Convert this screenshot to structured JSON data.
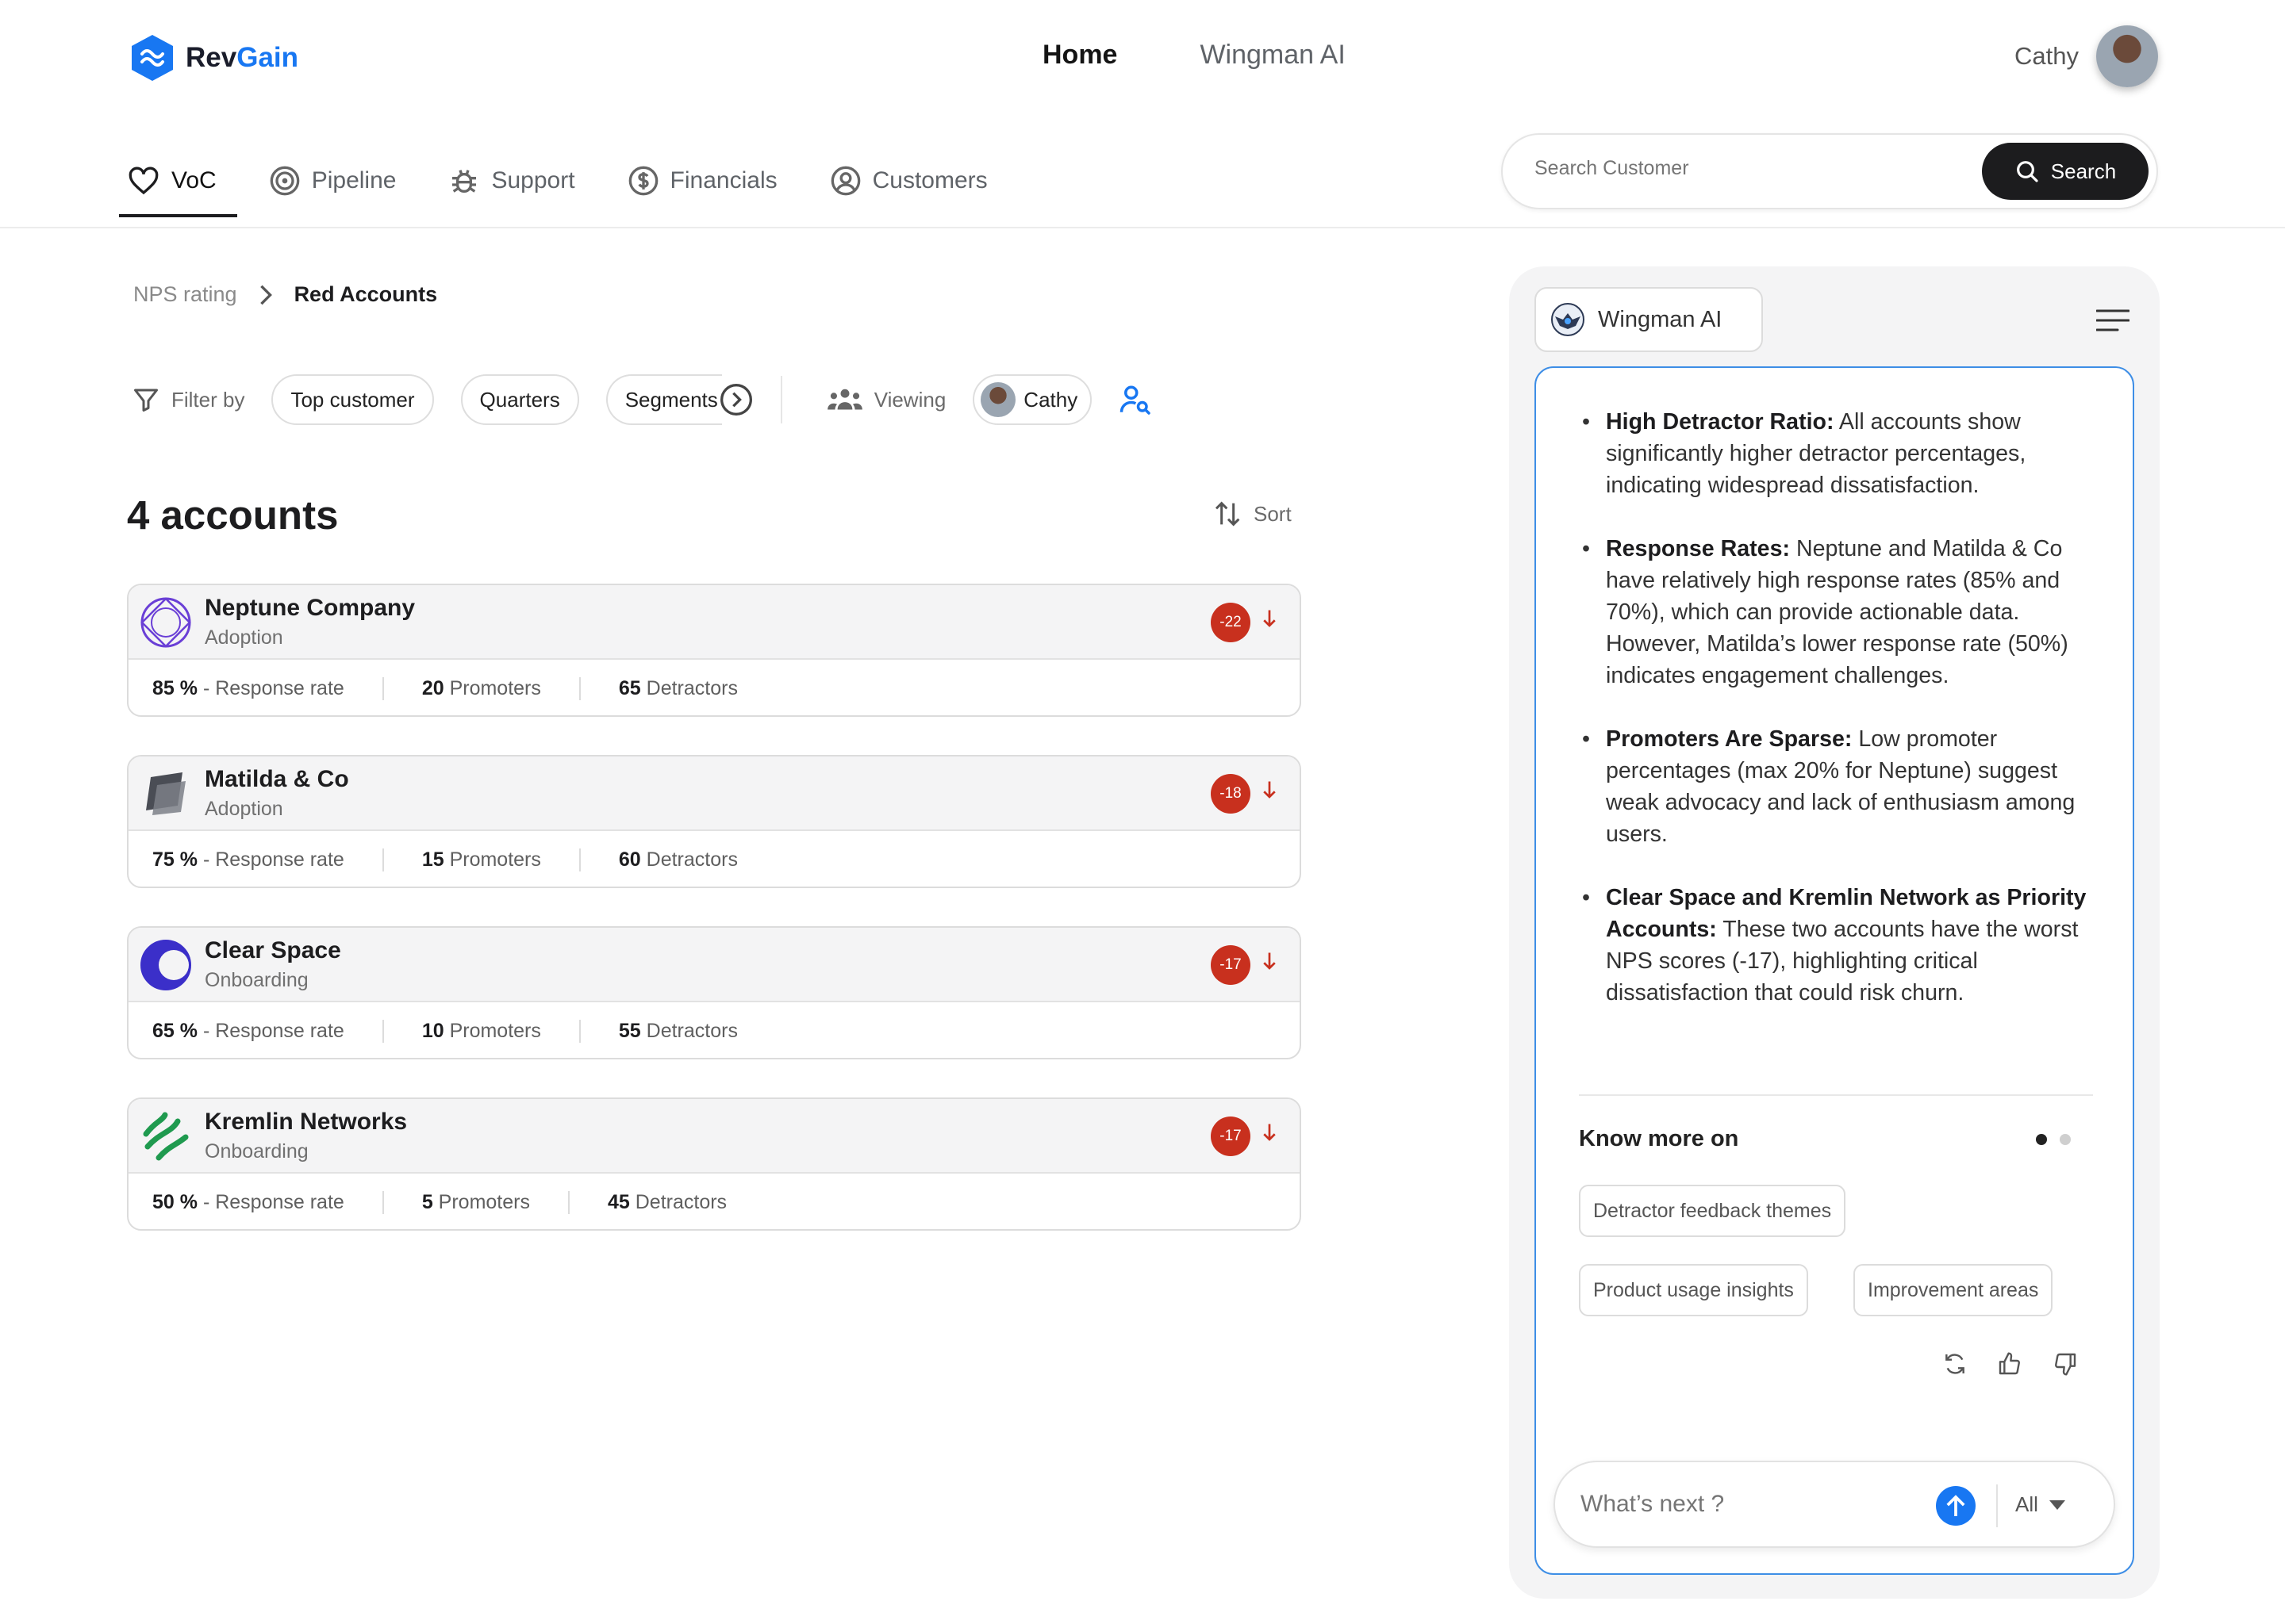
{
  "brand": {
    "name_part1": "Rev",
    "name_part2": "Gain",
    "accent": "#1877f2"
  },
  "topnav": [
    {
      "label": "Home",
      "active": true
    },
    {
      "label": "Wingman AI",
      "active": false
    }
  ],
  "user": {
    "name": "Cathy"
  },
  "subnav": [
    {
      "label": "VoC",
      "icon": "heart-icon",
      "active": true
    },
    {
      "label": "Pipeline",
      "icon": "target-icon"
    },
    {
      "label": "Support",
      "icon": "bug-icon"
    },
    {
      "label": "Financials",
      "icon": "dollar-icon"
    },
    {
      "label": "Customers",
      "icon": "user-circle-icon"
    }
  ],
  "search": {
    "placeholder": "Search Customer",
    "button": "Search"
  },
  "breadcrumb": {
    "parent": "NPS rating",
    "current": "Red Accounts"
  },
  "filters": {
    "label": "Filter by",
    "chips": [
      "Top customer",
      "Quarters",
      "Segments"
    ],
    "viewing_label": "Viewing",
    "viewing_user": "Cathy"
  },
  "accounts": {
    "title": "4 accounts",
    "sort_label": "Sort",
    "score_color": "#c8301e",
    "items": [
      {
        "name": "Neptune Company",
        "stage": "Adoption",
        "score": "-22",
        "response": "85 %",
        "response_label": "- Response rate",
        "promoters": "20",
        "promoters_label": "Promoters",
        "detractors": "65",
        "detractors_label": "Detractors"
      },
      {
        "name": "Matilda & Co",
        "stage": "Adoption",
        "score": "-18",
        "response": "75 %",
        "response_label": "- Response rate",
        "promoters": "15",
        "promoters_label": "Promoters",
        "detractors": "60",
        "detractors_label": "Detractors"
      },
      {
        "name": "Clear Space",
        "stage": "Onboarding",
        "score": "-17",
        "response": "65 %",
        "response_label": "- Response rate",
        "promoters": "10",
        "promoters_label": "Promoters",
        "detractors": "55",
        "detractors_label": "Detractors"
      },
      {
        "name": "Kremlin Networks",
        "stage": "Onboarding",
        "score": "-17",
        "response": "50 %",
        "response_label": "- Response rate",
        "promoters": "5",
        "promoters_label": "Promoters",
        "detractors": "45",
        "detractors_label": "Detractors"
      }
    ]
  },
  "wingman": {
    "title": "Wingman AI",
    "insights": [
      {
        "heading": "High Detractor Ratio:",
        "text": " All accounts show significantly higher detractor percentages, indicating widespread dissatisfaction."
      },
      {
        "heading": "Response Rates:",
        "text": " Neptune and Matilda & Co have relatively high response rates (85% and 70%), which can provide actionable data. However, Matilda’s lower response rate (50%) indicates engagement challenges."
      },
      {
        "heading": "Promoters Are Sparse:",
        "text": " Low promoter percentages (max 20% for Neptune) suggest weak advocacy and lack of enthusiasm among users."
      },
      {
        "heading": "Clear Space and Kremlin Network as Priority Accounts:",
        "text": " These two accounts have the worst NPS scores (-17), highlighting critical dissatisfaction that could risk churn."
      }
    ],
    "know_more_label": "Know more on",
    "suggestions": [
      "Detractor feedback themes",
      "Product usage insights",
      "Improvement areas"
    ],
    "ask_placeholder": "What’s next ?",
    "scope": "All"
  }
}
